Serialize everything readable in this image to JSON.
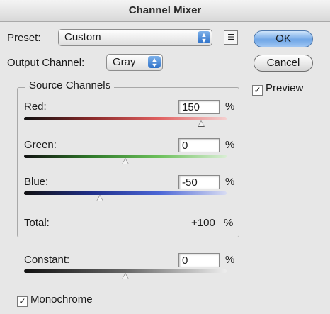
{
  "window": {
    "title": "Channel Mixer"
  },
  "preset": {
    "label": "Preset:",
    "value": "Custom"
  },
  "output_channel": {
    "label": "Output Channel:",
    "value": "Gray"
  },
  "buttons": {
    "ok": "OK",
    "cancel": "Cancel"
  },
  "preview": {
    "label": "Preview",
    "checked": true
  },
  "source_channels": {
    "title": "Source Channels",
    "red": {
      "label": "Red:",
      "value": "150",
      "unit": "%",
      "level": 150,
      "range": [
        -200,
        200
      ]
    },
    "green": {
      "label": "Green:",
      "value": "0",
      "unit": "%",
      "level": 0,
      "range": [
        -200,
        200
      ]
    },
    "blue": {
      "label": "Blue:",
      "value": "-50",
      "unit": "%",
      "level": -50,
      "range": [
        -200,
        200
      ]
    },
    "total": {
      "label": "Total:",
      "value": "+100",
      "unit": "%"
    }
  },
  "constant": {
    "label": "Constant:",
    "value": "0",
    "unit": "%",
    "level": 0,
    "range": [
      -200,
      200
    ]
  },
  "monochrome": {
    "label": "Monochrome",
    "checked": true
  },
  "colors": {
    "red_track": "#d34a4a",
    "green_track": "#5ab34a",
    "blue_track": "#3b55c9",
    "gray_track": "#333333"
  },
  "icons": {
    "popup_arrows": "up-down-arrows-icon",
    "menu": "list-menu-icon",
    "checkbox": "checkmark-icon"
  }
}
